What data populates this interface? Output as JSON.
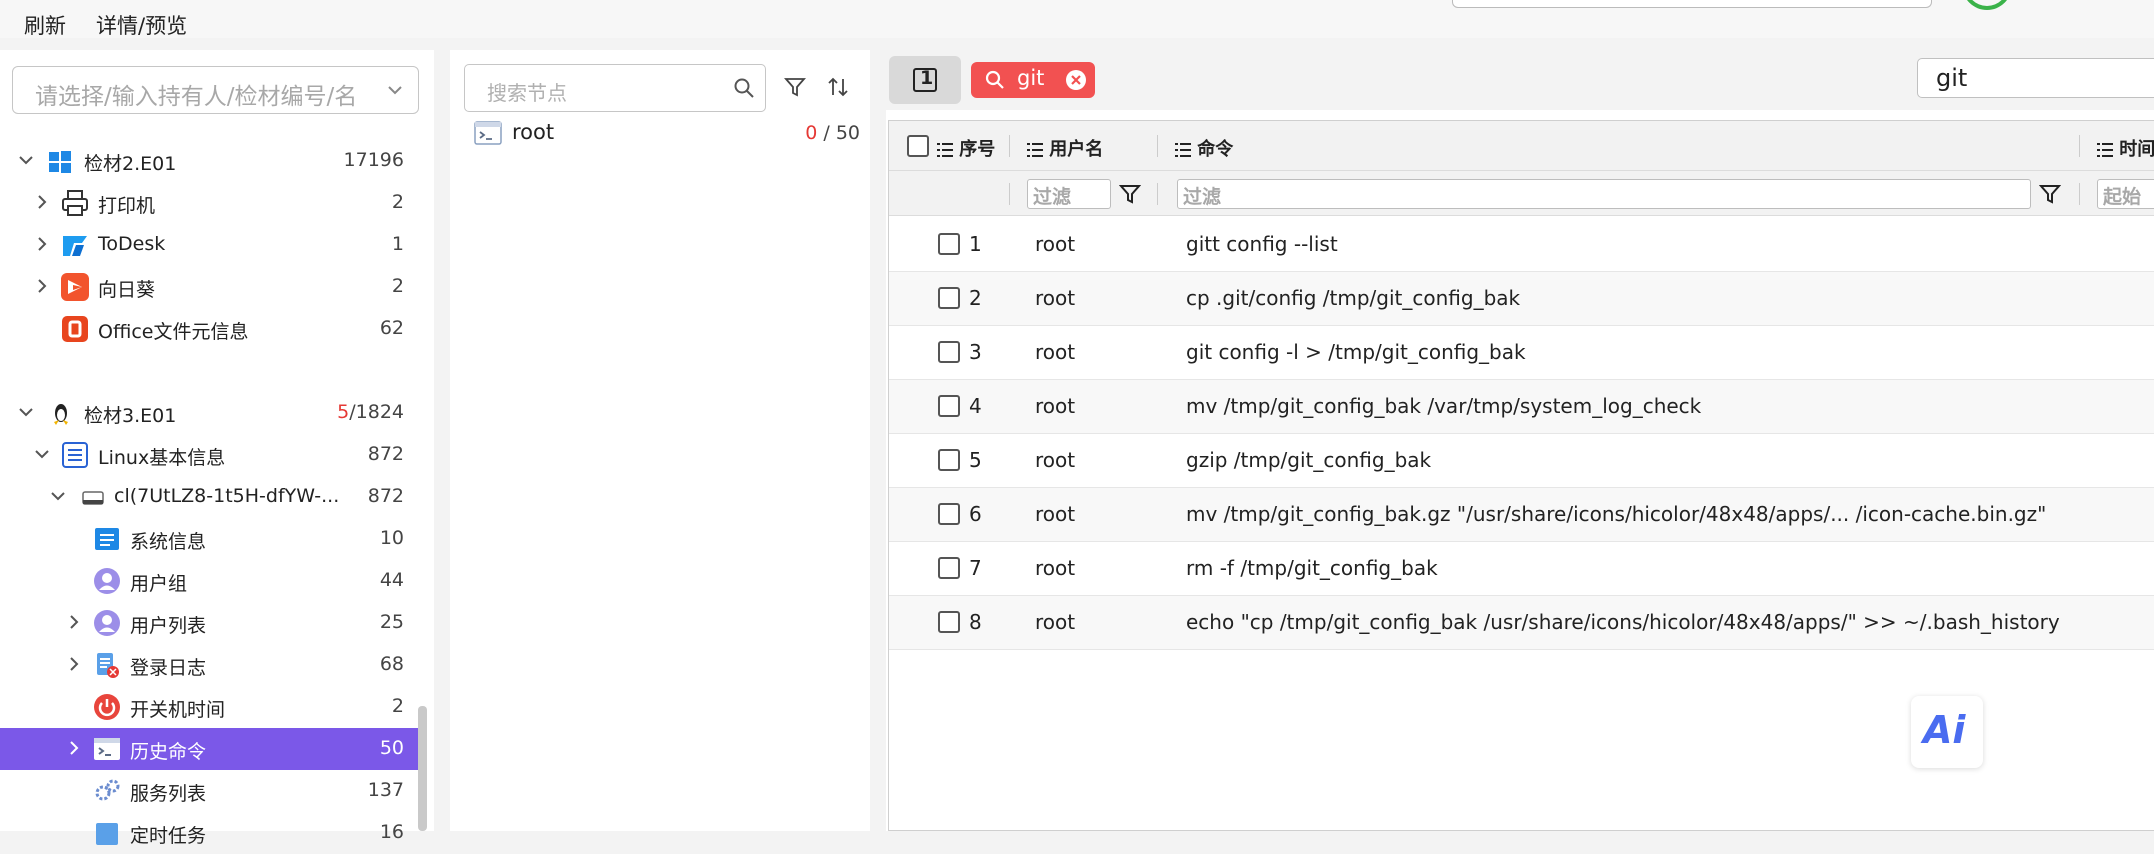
{
  "menu": {
    "refresh": "刷新",
    "details": "详情/预览"
  },
  "left": {
    "evidence_placeholder": "请选择/输入持有人/检材编号/名",
    "tree": [
      {
        "label": "检材2.E01",
        "count": "17196"
      },
      {
        "label": "打印机",
        "count": "2"
      },
      {
        "label": "ToDesk",
        "count": "1"
      },
      {
        "label": "向日葵",
        "count": "2"
      },
      {
        "label": "Office文件元信息",
        "count": "62"
      },
      {
        "label": "检材3.E01",
        "count_red": "5",
        "count_rest": "/1824"
      },
      {
        "label": "Linux基本信息",
        "count": "872"
      },
      {
        "label": "cl(7UtLZ8-1t5H-dfYW-...",
        "count": "872"
      },
      {
        "label": "系统信息",
        "count": "10"
      },
      {
        "label": "用户组",
        "count": "44"
      },
      {
        "label": "用户列表",
        "count": "25"
      },
      {
        "label": "登录日志",
        "count": "68"
      },
      {
        "label": "开关机时间",
        "count": "2"
      },
      {
        "label": "历史命令",
        "count": "50"
      },
      {
        "label": "服务列表",
        "count": "137"
      },
      {
        "label": "定时任务",
        "count": "16"
      }
    ]
  },
  "middle": {
    "search_placeholder": "搜索节点",
    "node": {
      "label": "root",
      "count_red": "0",
      "count_rest": "/ 50"
    }
  },
  "right": {
    "tab_number": "1",
    "filter_tag": "git",
    "search_value": "git",
    "columns": {
      "seq": "序号",
      "user": "用户名",
      "command": "命令",
      "time": "时间"
    },
    "filter_placeholder": "过滤",
    "time_filter_placeholder": "起始",
    "rows": [
      {
        "seq": "1",
        "user": "root",
        "command": "gitt config --list"
      },
      {
        "seq": "2",
        "user": "root",
        "command": "cp .git/config /tmp/git_config_bak"
      },
      {
        "seq": "3",
        "user": "root",
        "command": "git config -l > /tmp/git_config_bak"
      },
      {
        "seq": "4",
        "user": "root",
        "command": "mv /tmp/git_config_bak /var/tmp/system_log_check"
      },
      {
        "seq": "5",
        "user": "root",
        "command": "gzip /tmp/git_config_bak"
      },
      {
        "seq": "6",
        "user": "root",
        "command": "mv /tmp/git_config_bak.gz \"/usr/share/icons/hicolor/48x48/apps/... /icon-cache.bin.gz\""
      },
      {
        "seq": "7",
        "user": "root",
        "command": "rm -f /tmp/git_config_bak"
      },
      {
        "seq": "8",
        "user": "root",
        "command": "echo \"cp /tmp/git_config_bak /usr/share/icons/hicolor/48x48/apps/\" >> ~/.bash_history"
      }
    ],
    "ai_label": "Ai"
  },
  "colors": {
    "accent": "#7b58e8",
    "tag": "#f25151",
    "highlight": "#e53935"
  }
}
